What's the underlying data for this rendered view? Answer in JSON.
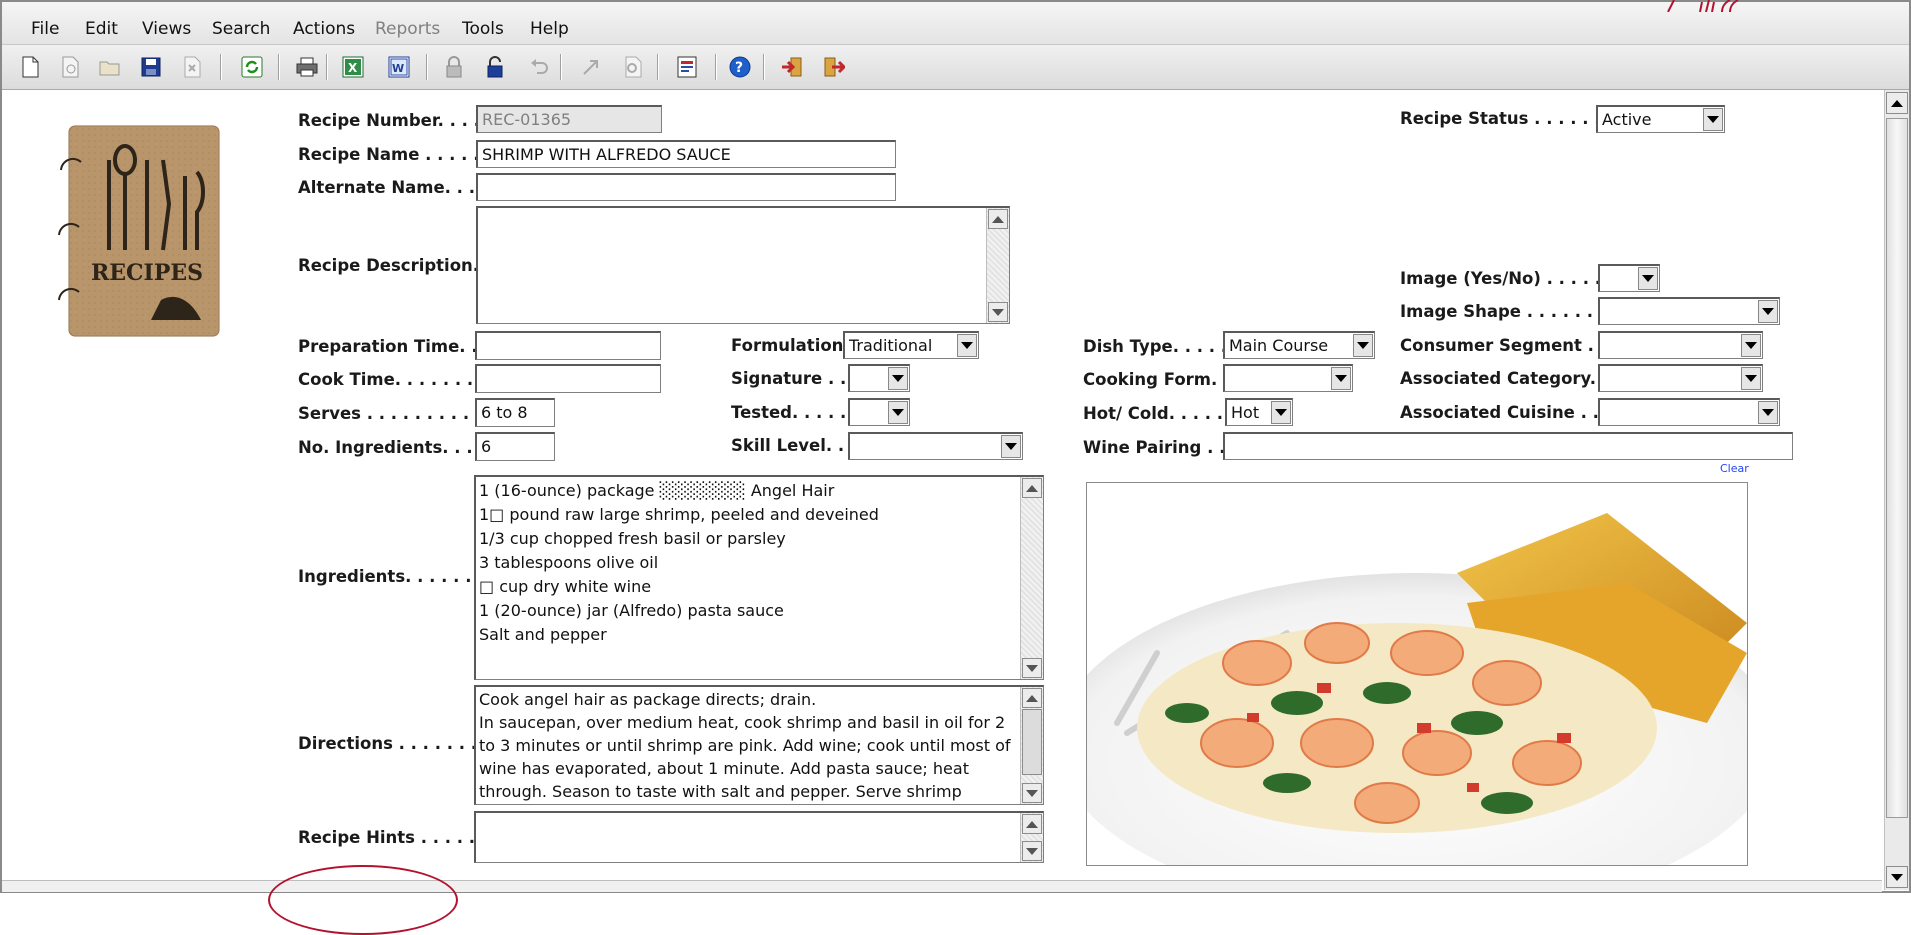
{
  "menu": {
    "items": [
      "File",
      "Edit",
      "Views",
      "Search",
      "Actions",
      "Reports",
      "Tools",
      "Help"
    ],
    "disabled": [
      "Reports"
    ]
  },
  "toolbar": {
    "icons": [
      "new-document-icon",
      "print-preview-icon",
      "open-folder-icon",
      "save-disk-icon",
      "delete-icon",
      "refresh-icon",
      "print-icon",
      "excel-export-icon",
      "word-export-icon",
      "lock-icon",
      "unlock-icon",
      "undo-icon",
      "send-icon",
      "find-icon",
      "report-icon",
      "help-icon",
      "import-icon",
      "exit-icon"
    ]
  },
  "form": {
    "recipe_number": {
      "label": "Recipe Number. . . . .",
      "value": "REC-01365"
    },
    "recipe_name": {
      "label": "Recipe Name . . . . . . .",
      "value": "SHRIMP WITH ALFREDO SAUCE"
    },
    "alternate_name": {
      "label": "Alternate Name. . . . .",
      "value": ""
    },
    "recipe_description": {
      "label": "Recipe Description. .",
      "value": ""
    },
    "preparation_time": {
      "label": "Preparation Time. . .",
      "value": ""
    },
    "cook_time": {
      "label": "Cook Time. . . . . . . . .",
      "value": ""
    },
    "serves": {
      "label": "Serves . . . . . . . . . . . .",
      "value": "6 to 8"
    },
    "no_ingredients": {
      "label": "No. Ingredients. . . . .",
      "value": "6"
    },
    "formulation": {
      "label": "Formulation.",
      "value": "Traditional"
    },
    "signature": {
      "label": "Signature . . .",
      "value": ""
    },
    "tested": {
      "label": "Tested. . . . . .",
      "value": ""
    },
    "skill_level": {
      "label": "Skill Level. . .",
      "value": ""
    },
    "dish_type": {
      "label": "Dish Type. . . . . .",
      "value": "Main Course"
    },
    "cooking_form": {
      "label": "Cooking Form. .",
      "value": ""
    },
    "hot_cold": {
      "label": "Hot/ Cold. . . . . . .",
      "value": "Hot"
    },
    "wine_pairing": {
      "label": "Wine Pairing . . .",
      "value": ""
    },
    "recipe_status": {
      "label": "Recipe Status . . . . . . . .",
      "value": "Active"
    },
    "image_yes_no": {
      "label": "Image (Yes/No) . . . . . . .",
      "value": ""
    },
    "image_shape": {
      "label": "Image Shape . . . . . . . . .",
      "value": ""
    },
    "consumer_segment": {
      "label": "Consumer Segment . .",
      "value": ""
    },
    "associated_category": {
      "label": "Associated Category. .",
      "value": ""
    },
    "associated_cuisine": {
      "label": "Associated Cuisine . . .",
      "value": ""
    },
    "ingredients": {
      "label": "Ingredients. . . . . . . .",
      "lines": [
        "1 (16-ounce) package ░░░░░░░ Angel Hair",
        "1□ pound raw large shrimp, peeled and deveined",
        "1/3 cup chopped fresh basil or parsley",
        "3 tablespoons olive oil",
        "□ cup dry white wine",
        "1 (20-ounce) jar (Alfredo) pasta sauce",
        "Salt and pepper"
      ]
    },
    "directions": {
      "label": "Directions . . . . . . . . .",
      "lines": [
        "Cook angel hair as package directs; drain.",
        "In saucepan, over medium heat, cook shrimp and basil in oil for 2 to 3 minutes or until shrimp are pink. Add wine; cook until most of wine has evaporated, about 1 minute. Add pasta sauce; heat through. Season to taste with salt and pepper. Serve shrimp mixture with hot angel hair."
      ]
    },
    "recipe_hints": {
      "label": "Recipe Hints . . . . . . .",
      "value": ""
    },
    "clear_link": "Clear",
    "logo_text": "RECIPES"
  }
}
